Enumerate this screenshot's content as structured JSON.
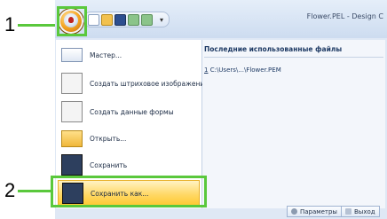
{
  "callouts": {
    "one": "1",
    "two": "2"
  },
  "window": {
    "title": "Flower.PEL - Design C"
  },
  "quick_access": {
    "dropdown_glyph": "▾"
  },
  "menu": {
    "items": [
      {
        "label": "Мастер...",
        "icon": "wizard-icon"
      },
      {
        "label": "Создать штриховое изображение",
        "icon": "line-image-icon"
      },
      {
        "label": "Создать данные формы",
        "icon": "shape-data-icon"
      },
      {
        "label": "Открыть...",
        "icon": "open-folder-icon"
      },
      {
        "label": "Сохранить",
        "icon": "save-icon"
      },
      {
        "label": "Сохранить как...",
        "icon": "save-as-icon"
      }
    ],
    "recent_heading": "Последние использованные файлы",
    "recent_files": [
      {
        "num": "1",
        "path": "C:\\Users\\...\\Flower.PEM"
      }
    ],
    "options_button": "Параметры",
    "exit_button": "Выход"
  },
  "colors": {
    "callout_green": "#5ac83c",
    "highlight": "#ffd866"
  }
}
